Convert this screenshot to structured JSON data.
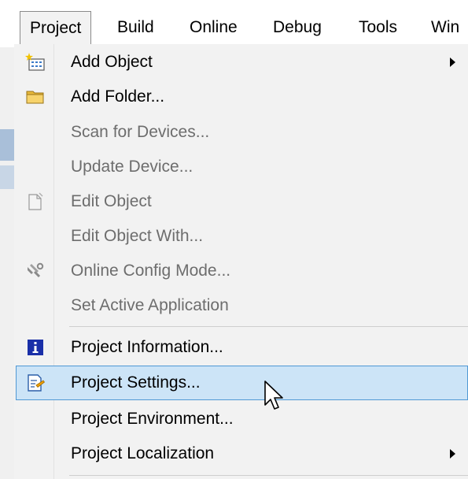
{
  "menubar": {
    "items": [
      {
        "label": "Project",
        "open": true
      },
      {
        "label": "Build"
      },
      {
        "label": "Online"
      },
      {
        "label": "Debug"
      },
      {
        "label": "Tools"
      },
      {
        "label": "Win"
      }
    ]
  },
  "menu": {
    "items": [
      {
        "label": "Add Object",
        "icon": "add-object-icon",
        "submenu": true,
        "enabled": true
      },
      {
        "label": "Add Folder...",
        "icon": "folder-icon",
        "enabled": true
      },
      {
        "label": "Scan for Devices...",
        "enabled": false
      },
      {
        "label": "Update Device...",
        "enabled": false
      },
      {
        "label": "Edit Object",
        "icon": "document-icon",
        "enabled": false
      },
      {
        "label": "Edit Object With...",
        "enabled": false
      },
      {
        "label": "Online Config Mode...",
        "icon": "tools-icon",
        "enabled": false
      },
      {
        "label": "Set Active Application",
        "enabled": false
      },
      {
        "label": "Project Information...",
        "icon": "info-icon",
        "enabled": true
      },
      {
        "label": "Project Settings...",
        "icon": "settings-icon",
        "enabled": true,
        "highlighted": true
      },
      {
        "label": "Project Environment...",
        "enabled": true
      },
      {
        "label": "Project Localization",
        "submenu": true,
        "enabled": true
      }
    ]
  },
  "colors": {
    "highlight_bg": "#cce4f7",
    "highlight_border": "#4f98d4",
    "disabled_text": "#6d6d6d",
    "info_icon": "#1a2fa8"
  }
}
